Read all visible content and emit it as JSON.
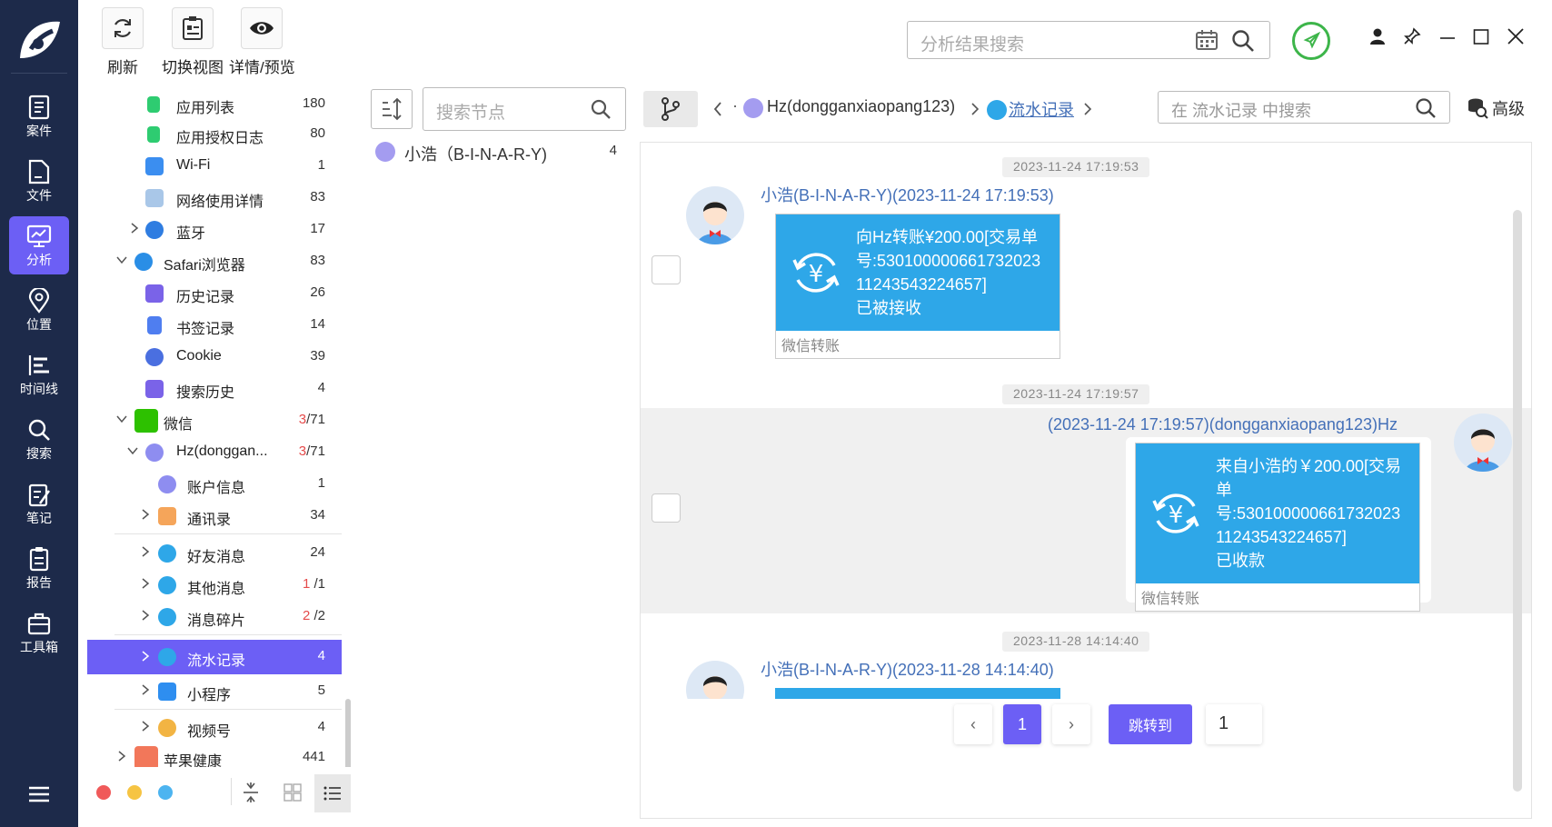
{
  "nav": {
    "items": [
      {
        "label": "案件",
        "icon": "case-icon"
      },
      {
        "label": "文件",
        "icon": "file-icon"
      },
      {
        "label": "分析",
        "icon": "analysis-icon",
        "active": true
      },
      {
        "label": "位置",
        "icon": "location-icon"
      },
      {
        "label": "时间线",
        "icon": "timeline-icon"
      },
      {
        "label": "搜索",
        "icon": "search-icon"
      },
      {
        "label": "笔记",
        "icon": "note-icon"
      },
      {
        "label": "报告",
        "icon": "report-icon"
      },
      {
        "label": "工具箱",
        "icon": "toolbox-icon"
      }
    ]
  },
  "toolbar": {
    "refresh_label": "刷新",
    "switch_view_label": "切换视图",
    "detail_label": "详情/预览"
  },
  "top_search": {
    "placeholder": "分析结果搜索"
  },
  "tree": {
    "rows": [
      {
        "label": "应用列表",
        "count": "180"
      },
      {
        "label": "应用授权日志",
        "count": "80"
      },
      {
        "label": "Wi-Fi",
        "count": "1"
      },
      {
        "label": "网络使用详情",
        "count": "83"
      },
      {
        "label": "蓝牙",
        "count": "17"
      },
      {
        "label": "Safari浏览器",
        "count": "83"
      },
      {
        "label": "历史记录",
        "count": "26"
      },
      {
        "label": "书签记录",
        "count": "14"
      },
      {
        "label": "Cookie",
        "count": "39"
      },
      {
        "label": "搜索历史",
        "count": "4"
      },
      {
        "label": "微信",
        "count_red": "3",
        "count": "/71"
      },
      {
        "label": "Hz(donggan...",
        "count_red": "3",
        "count": "/71"
      },
      {
        "label": "账户信息",
        "count": "1"
      },
      {
        "label": "通讯录",
        "count": "34"
      },
      {
        "label": "好友消息",
        "count": "24"
      },
      {
        "label": "其他消息",
        "count_red": "1",
        "count": "/1"
      },
      {
        "label": "消息碎片",
        "count_red": "2",
        "count": "/2"
      },
      {
        "label": "流水记录",
        "count": "4"
      },
      {
        "label": "小程序",
        "count": "5"
      },
      {
        "label": "视频号",
        "count": "4"
      },
      {
        "label": "苹果健康",
        "count": "441"
      }
    ]
  },
  "nodes": {
    "search_placeholder": "搜索节点",
    "items": [
      {
        "label": "小浩（B-I-N-A-R-Y)",
        "count": "4"
      }
    ]
  },
  "breadcrumb": {
    "dot": "·",
    "account": "Hz(dongganxiaopang123)",
    "current": "流水记录",
    "search_placeholder": "在 流水记录 中搜索",
    "advanced_label": "高级"
  },
  "messages": [
    {
      "timestamp": "2023-11-24 17:19:53",
      "sender": "小浩(B-I-N-A-R-Y)(2023-11-24 17:19:53)",
      "text_lines": [
        "向Hz转账¥200.00[交易单",
        "号:530100000661732023",
        "11243543224657]",
        "已被接收"
      ],
      "footer": "微信转账"
    },
    {
      "timestamp": "2023-11-24 17:19:57",
      "sender": "(2023-11-24 17:19:57)(dongganxiaopang123)Hz",
      "text_lines": [
        "来自小浩的￥200.00[交易",
        "单",
        "号:530100000661732023",
        "11243543224657]",
        "已收款"
      ],
      "footer": "微信转账"
    },
    {
      "timestamp": "2023-11-28 14:14:40",
      "sender": "小浩(B-I-N-A-R-Y)(2023-11-28 14:14:40)"
    }
  ],
  "pager": {
    "prev": "‹",
    "current": "1",
    "next": "›",
    "jump_label": "跳转到",
    "page_value": "1"
  },
  "colors": {
    "accent": "#6c5ff5",
    "nav_bg": "#1d2a4a",
    "card_blue": "#2ea7e8",
    "link_blue": "#4470b8"
  }
}
